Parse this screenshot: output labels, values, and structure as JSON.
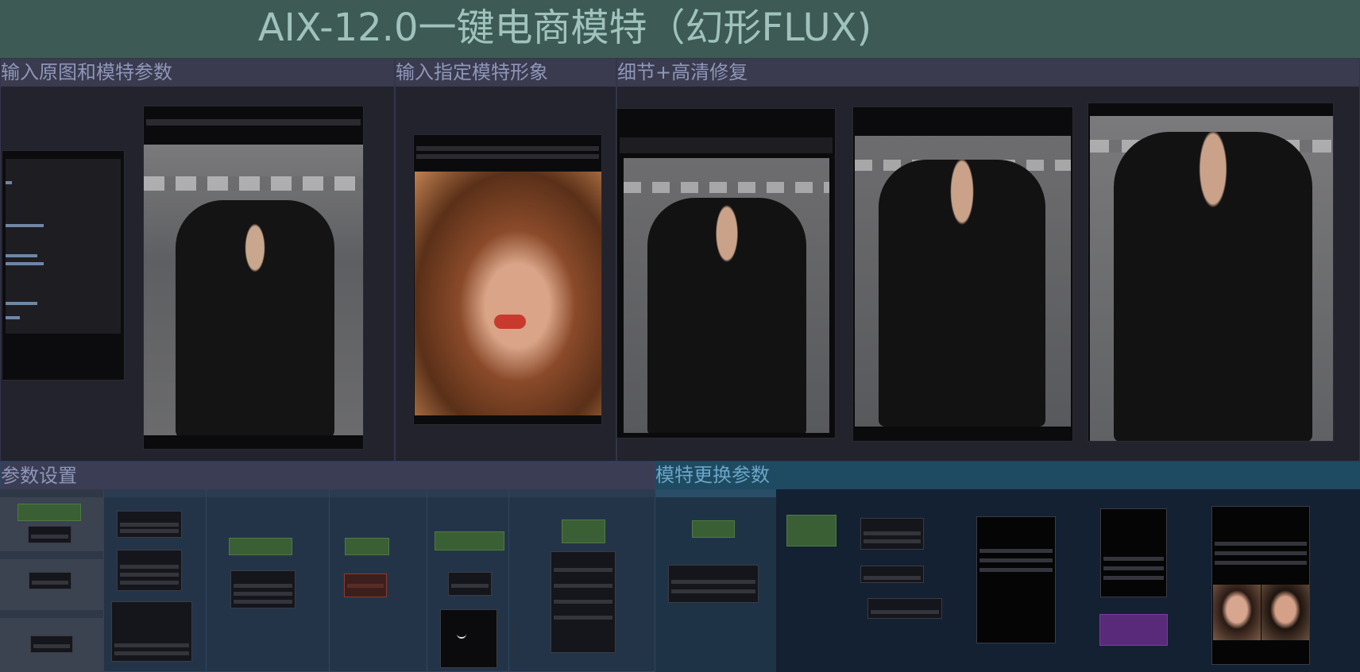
{
  "title": "AIX-12.0一键电商模特（幻形FLUX)",
  "groups": {
    "input_original": "输入原图和模特参数",
    "input_model": "输入指定模特形象",
    "detail_fix": "细节+高清修复",
    "params": "参数设置",
    "model_swap": "模特更换参数"
  },
  "images": {
    "original": "photo: woman in black blazer walking on crosswalk",
    "model_ref": "photo: close-up portrait of curly red-haired woman",
    "result_1": "photo: generated model in black blazer on street",
    "result_2": "photo: generated model in black blazer on street",
    "result_3": "photo: generated model in black blazer on street",
    "thumb_a": "photo: face thumbnail",
    "thumb_b": "photo: face thumbnail"
  },
  "colors": {
    "title_bg": "#3d5a55",
    "title_text": "#9fc3bc",
    "group_header": "#3a3b4e",
    "group_label": "#8f96b8",
    "swap_header": "#1e4a62",
    "node_green": "#3b5f34",
    "node_purple": "#5a2a7a",
    "node_red": "#7a3a30"
  }
}
